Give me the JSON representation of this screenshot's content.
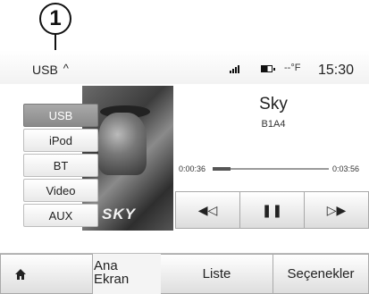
{
  "callout": {
    "number": "1"
  },
  "status": {
    "source_label": "USB",
    "source_chevron": "^",
    "temperature": "--°F",
    "clock": "15:30",
    "icons": [
      "signal-icon",
      "battery-icon"
    ]
  },
  "sources": [
    {
      "label": "USB",
      "selected": true
    },
    {
      "label": "iPod",
      "selected": false
    },
    {
      "label": "BT",
      "selected": false
    },
    {
      "label": "Video",
      "selected": false
    },
    {
      "label": "AUX",
      "selected": false
    }
  ],
  "album": {
    "art_text": "SKY"
  },
  "track": {
    "title": "Sky",
    "subtitle": "B1A4",
    "elapsed": "0:00:36",
    "total": "0:03:56",
    "progress": 0.15
  },
  "controls": {
    "prev": "◀◁",
    "pause": "❚❚",
    "next": "▷▶"
  },
  "bottom": {
    "home_label": "Ana Ekran",
    "list_label": "Liste",
    "options_label": "Seçenekler"
  },
  "colors": {
    "selected_source": "#8a8a8a",
    "background": "#ffffff"
  }
}
